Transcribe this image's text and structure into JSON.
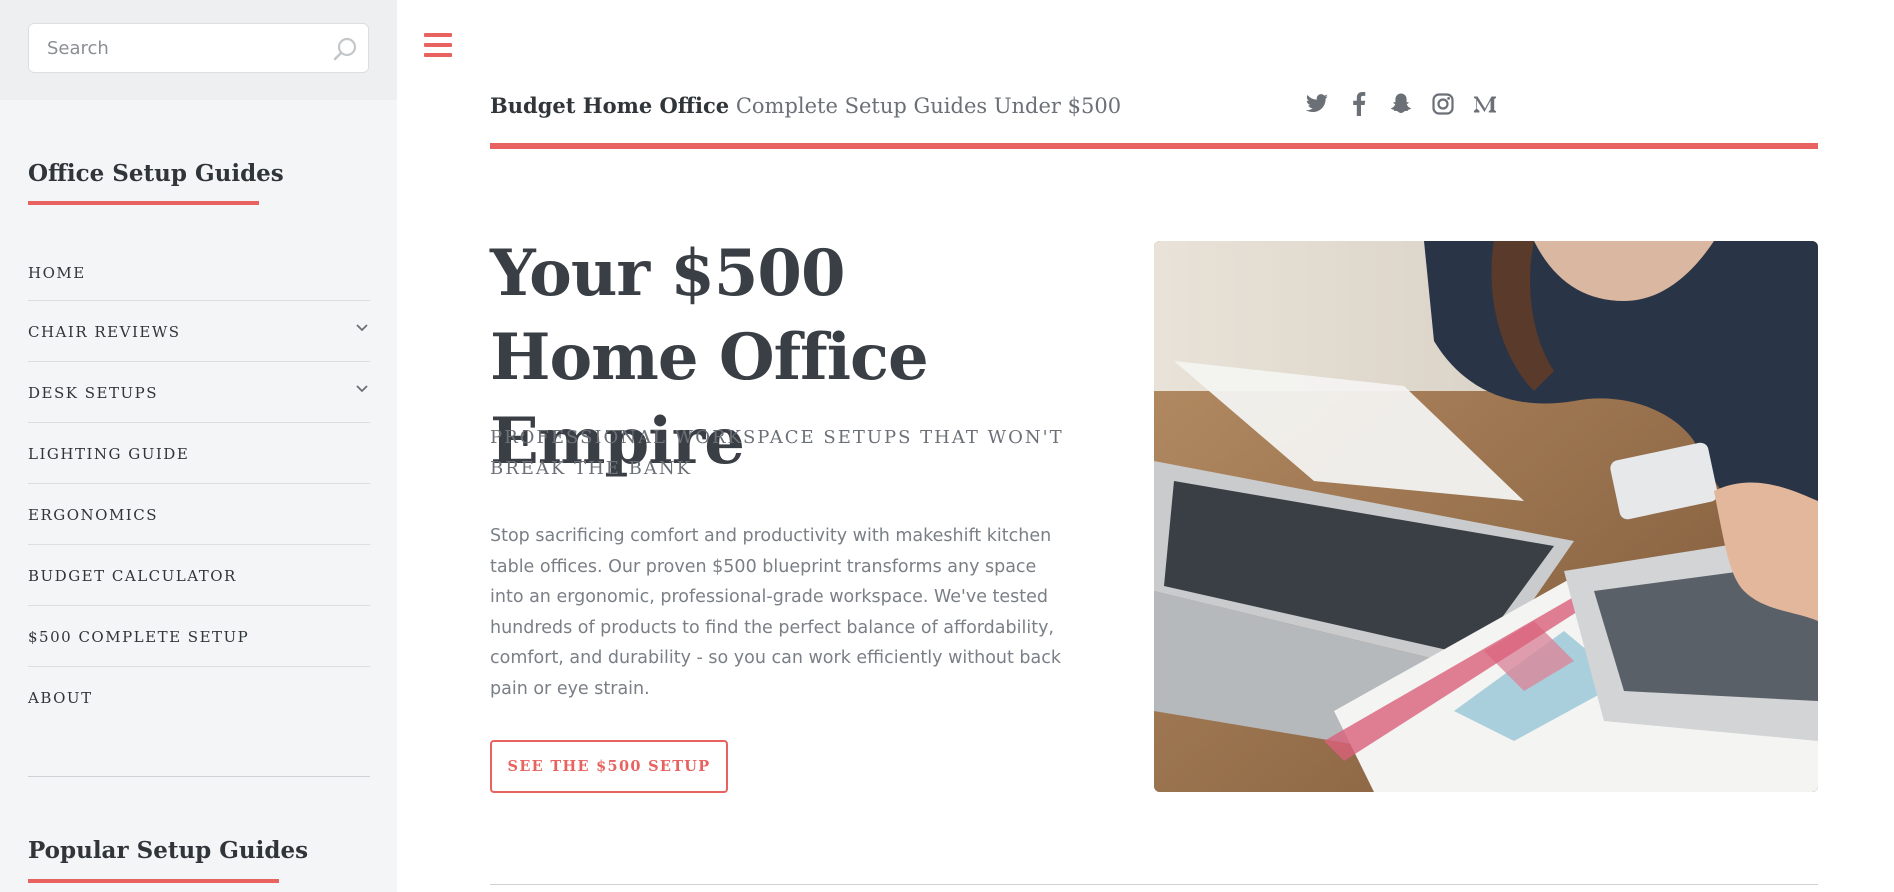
{
  "search": {
    "placeholder": "Search"
  },
  "sidebar": {
    "heading": "Office Setup Guides",
    "items": [
      {
        "label": "HOME",
        "has_submenu": false
      },
      {
        "label": "CHAIR REVIEWS",
        "has_submenu": true
      },
      {
        "label": "DESK SETUPS",
        "has_submenu": true
      },
      {
        "label": "LIGHTING GUIDE",
        "has_submenu": false
      },
      {
        "label": "ERGONOMICS",
        "has_submenu": false
      },
      {
        "label": "BUDGET CALCULATOR",
        "has_submenu": false
      },
      {
        "label": "$500 COMPLETE SETUP",
        "has_submenu": false
      },
      {
        "label": "ABOUT",
        "has_submenu": false
      }
    ],
    "popular_heading": "Popular Setup Guides"
  },
  "header": {
    "brand_name": "Budget Home Office",
    "tagline": "Complete Setup Guides Under $500",
    "social": [
      "twitter-icon",
      "facebook-icon",
      "snapchat-icon",
      "instagram-icon",
      "medium-icon"
    ]
  },
  "hero": {
    "title": "Your $500 Home Office Empire",
    "subtitle": "PROFESSIONAL WORKSPACE SETUPS THAT WON'T BREAK THE BANK",
    "body": "Stop sacrificing comfort and productivity with makeshift kitchen table offices. Our proven $500 blueprint transforms any space into an ergonomic, professional-grade workspace. We've tested hundreds of products to find the perfect balance of affordability, comfort, and durability - so you can work efficiently without back pain or eye strain.",
    "cta_label": "SEE THE $500 SETUP"
  },
  "colors": {
    "accent": "#e8635f",
    "text": "#3a3f45",
    "muted": "#6b7077",
    "sidebar_bg": "#f4f5f6"
  }
}
